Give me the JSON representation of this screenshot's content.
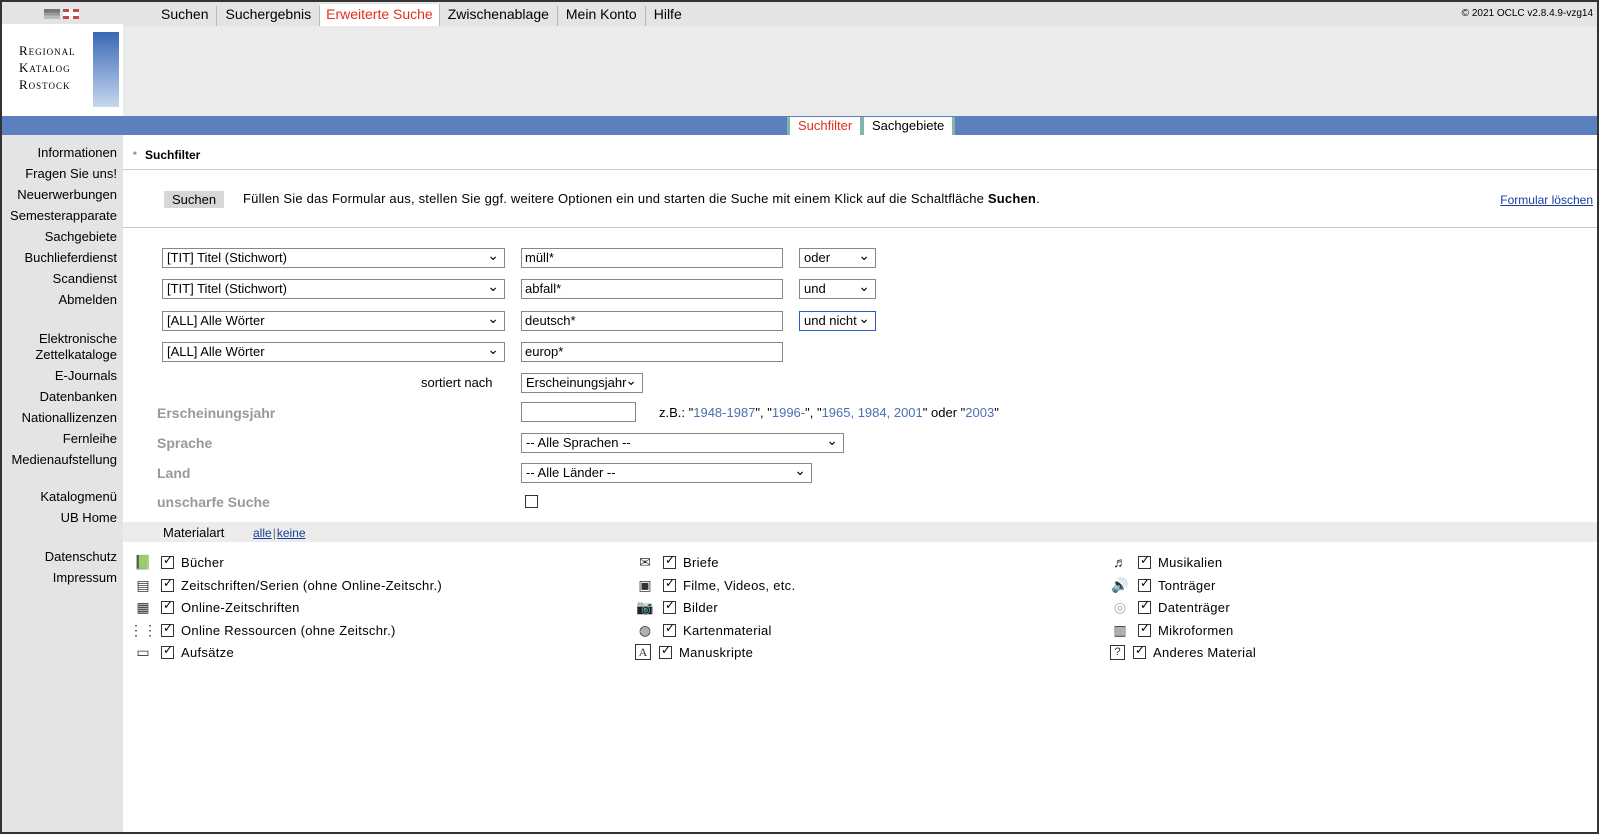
{
  "nav": {
    "items": [
      "Suchen",
      "Suchergebnis",
      "Erweiterte Suche",
      "Zwischenablage",
      "Mein Konto",
      "Hilfe"
    ],
    "copyright": "© 2021 OCLC v2.8.4.9-vzg14"
  },
  "logo": {
    "line1": "Regional",
    "line2": "Katalog",
    "line3": "Rostock"
  },
  "tabs": {
    "t1": "Suchfilter",
    "t2": "Sachgebiete"
  },
  "leftnav": {
    "i1": "Informationen",
    "i2": "Fragen Sie uns!",
    "i3": "Neuerwerbungen",
    "i4": "Semesterapparate",
    "i5": "Sachgebiete",
    "i6": "Buchlieferdienst",
    "i7": "Scandienst",
    "i8": "Abmelden",
    "i9a": "Elektronische",
    "i9b": "Zettelkataloge",
    "i10": "E-Journals",
    "i11": "Datenbanken",
    "i12": "Nationallizenzen",
    "i13": "Fernleihe",
    "i14": "Medienaufstellung",
    "i15": "Katalogmenü",
    "i16": "UB Home",
    "i17": "Datenschutz",
    "i18": "Impressum"
  },
  "form": {
    "section_title": "Suchfilter",
    "search_label": "Suchen",
    "intro_pre": "Füllen Sie das Formular aus, stellen Sie ggf. weitere Optionen ein und starten die Suche mit einem Klick auf die Schaltfläche ",
    "intro_bold": "Suchen",
    "intro_post": ".",
    "clear_label": "Formular löschen",
    "rows": [
      {
        "field": "[TIT] Titel (Stichwort)",
        "value": "müll*",
        "op": "oder"
      },
      {
        "field": "[TIT] Titel (Stichwort)",
        "value": "abfall*",
        "op": "und"
      },
      {
        "field": "[ALL] Alle Wörter",
        "value": "deutsch*",
        "op": "und nicht"
      },
      {
        "field": "[ALL] Alle Wörter",
        "value": "europ*",
        "op": ""
      }
    ],
    "sort_label": "sortiert nach",
    "sort_value": "Erscheinungsjahr",
    "year_label": "Erscheinungsjahr",
    "year_value": "",
    "example_pre": "z.B.: \"",
    "ex1": "1948-1987",
    "ex_sep1": "\", \"",
    "ex2": "1996-",
    "ex_sep2": "\", \"",
    "ex3": "1965, 1984, 2001",
    "ex_sep3": "\" oder \"",
    "ex4": "2003",
    "example_post": "\"",
    "lang_label": "Sprache",
    "lang_value": "-- Alle Sprachen --",
    "country_label": "Land",
    "country_value": "-- Alle Länder --",
    "fuzzy_label": "unscharfe Suche",
    "fuzzy_checked": false
  },
  "materials": {
    "title": "Materialart",
    "all": "alle",
    "none": "keine",
    "col1": [
      {
        "icon": "book-icon",
        "label": "Bücher"
      },
      {
        "icon": "journal-icon",
        "label": "Zeitschriften/Serien (ohne Online-Zeitschr.)"
      },
      {
        "icon": "online-journal-icon",
        "label": "Online-Zeitschriften"
      },
      {
        "icon": "online-resource-icon",
        "label": "Online Ressourcen (ohne Zeitschr.)"
      },
      {
        "icon": "article-icon",
        "label": "Aufsätze"
      }
    ],
    "col2": [
      {
        "icon": "letter-icon",
        "label": "Briefe"
      },
      {
        "icon": "film-icon",
        "label": "Filme, Videos, etc."
      },
      {
        "icon": "camera-icon",
        "label": "Bilder"
      },
      {
        "icon": "globe-icon",
        "label": "Kartenmaterial"
      },
      {
        "icon": "manuscript-icon",
        "label": "Manuskripte"
      }
    ],
    "col3": [
      {
        "icon": "music-icon",
        "label": "Musikalien"
      },
      {
        "icon": "speaker-icon",
        "label": "Tonträger"
      },
      {
        "icon": "disc-icon",
        "label": "Datenträger"
      },
      {
        "icon": "microform-icon",
        "label": "Mikroformen"
      },
      {
        "icon": "question-icon",
        "label": "Anderes Material"
      }
    ]
  }
}
